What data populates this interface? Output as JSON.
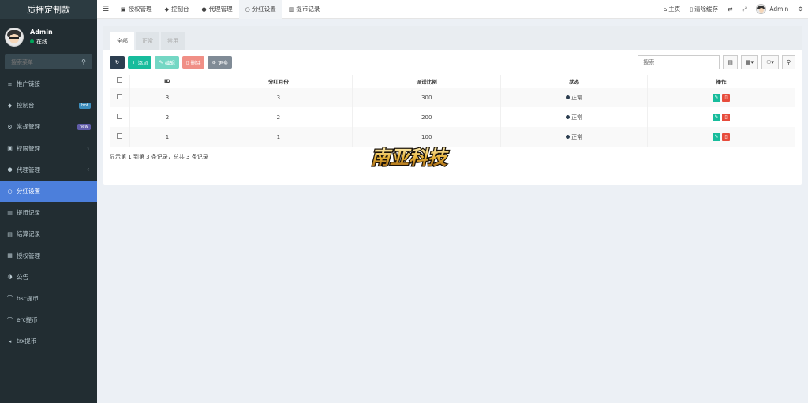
{
  "brand": "质押定制款",
  "user": {
    "name": "Admin",
    "status": "在线"
  },
  "sidebar": {
    "search_placeholder": "搜索菜单",
    "items": [
      {
        "icon": "≡",
        "label": "推广链接"
      },
      {
        "icon": "◆",
        "label": "控制台",
        "badge": "hot"
      },
      {
        "icon": "⚙",
        "label": "常规管理",
        "badge": "new"
      },
      {
        "icon": "▣",
        "label": "权限管理",
        "chevron": "‹"
      },
      {
        "icon": "●",
        "label": "代理管理",
        "chevron": "‹"
      },
      {
        "icon": "○",
        "label": "分红设置"
      },
      {
        "icon": "▥",
        "label": "提币记录"
      },
      {
        "icon": "▤",
        "label": "结算记录"
      },
      {
        "icon": "▦",
        "label": "授权管理"
      },
      {
        "icon": "◑",
        "label": "公告"
      },
      {
        "icon": "⌒",
        "label": "bsc提币"
      },
      {
        "icon": "⌒",
        "label": "erc提币"
      },
      {
        "icon": "◂",
        "label": "trx提币"
      }
    ]
  },
  "topnav": {
    "tabs": [
      {
        "icon": "▣",
        "label": "授权管理"
      },
      {
        "icon": "◆",
        "label": "控制台"
      },
      {
        "icon": "●",
        "label": "代理管理"
      },
      {
        "icon": "○",
        "label": "分红设置"
      },
      {
        "icon": "▥",
        "label": "提币记录"
      }
    ],
    "home": "主页",
    "clear_cache": "清除缓存",
    "admin": "Admin"
  },
  "panel": {
    "tabs": [
      "全部",
      "正常",
      "禁用"
    ],
    "toolbar": {
      "add": "添加",
      "edit": "编辑",
      "delete": "删除",
      "more": "更多"
    },
    "search_placeholder": "搜索"
  },
  "table": {
    "headers": [
      "ID",
      "分红月份",
      "派送比例",
      "状态",
      "操作"
    ],
    "rows": [
      {
        "id": "3",
        "month": "3",
        "ratio": "300",
        "status": "正常"
      },
      {
        "id": "2",
        "month": "2",
        "ratio": "200",
        "status": "正常"
      },
      {
        "id": "1",
        "month": "1",
        "ratio": "100",
        "status": "正常"
      }
    ]
  },
  "footer": "显示第 1 到第 3 条记录，总共 3 条记录",
  "watermark": "南亚科技"
}
